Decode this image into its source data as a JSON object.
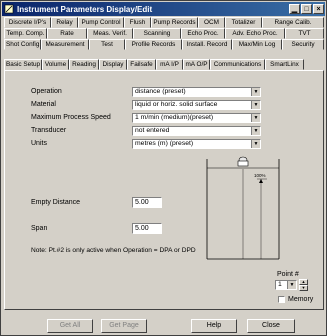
{
  "window": {
    "title": "Instrument Parameters Display/Edit"
  },
  "tabs": {
    "row1": [
      "Discrete I/P's",
      "Relay",
      "Pump Control",
      "Flush",
      "Pump Records",
      "OCM",
      "Totalizer",
      "Range Calib."
    ],
    "row2": [
      "Temp. Comp.",
      "Rate",
      "Meas. Verif.",
      "Scanning",
      "Echo Proc.",
      "Adv. Echo Proc.",
      "TVT"
    ],
    "row3": [
      "Shot Config.",
      "Measurement",
      "Test",
      "Profile Records",
      "Install. Record",
      "Max/Min Log",
      "Security"
    ],
    "row4": [
      "Basic Setup",
      "Volume",
      "Reading",
      "Display",
      "Failsafe",
      "mA I/P",
      "mA O/P",
      "Communications",
      "SmartLinx"
    ],
    "active": "Basic Setup"
  },
  "form": {
    "rows": [
      {
        "label": "Operation",
        "value": "distance (preset)"
      },
      {
        "label": "Material",
        "value": "liquid or horiz. solid surface"
      },
      {
        "label": "Maximum Process Speed",
        "value": "1   m/min (medium)(preset)"
      },
      {
        "label": "Transducer",
        "value": "not entered"
      },
      {
        "label": "Units",
        "value": "metres (m) (preset)"
      }
    ],
    "empty_distance": {
      "label": "Empty Distance",
      "value": "5.00"
    },
    "span": {
      "label": "Span",
      "value": "5.00"
    },
    "note": "Note: Pt.#2 is only active when Operation = DPA or DPD"
  },
  "diagram": {
    "percent_label": "100%"
  },
  "point": {
    "label": "Point #",
    "value": "1",
    "memory_label": "Memory"
  },
  "buttons": {
    "get_all": "Get All",
    "get_page": "Get Page",
    "help": "Help",
    "close": "Close"
  }
}
